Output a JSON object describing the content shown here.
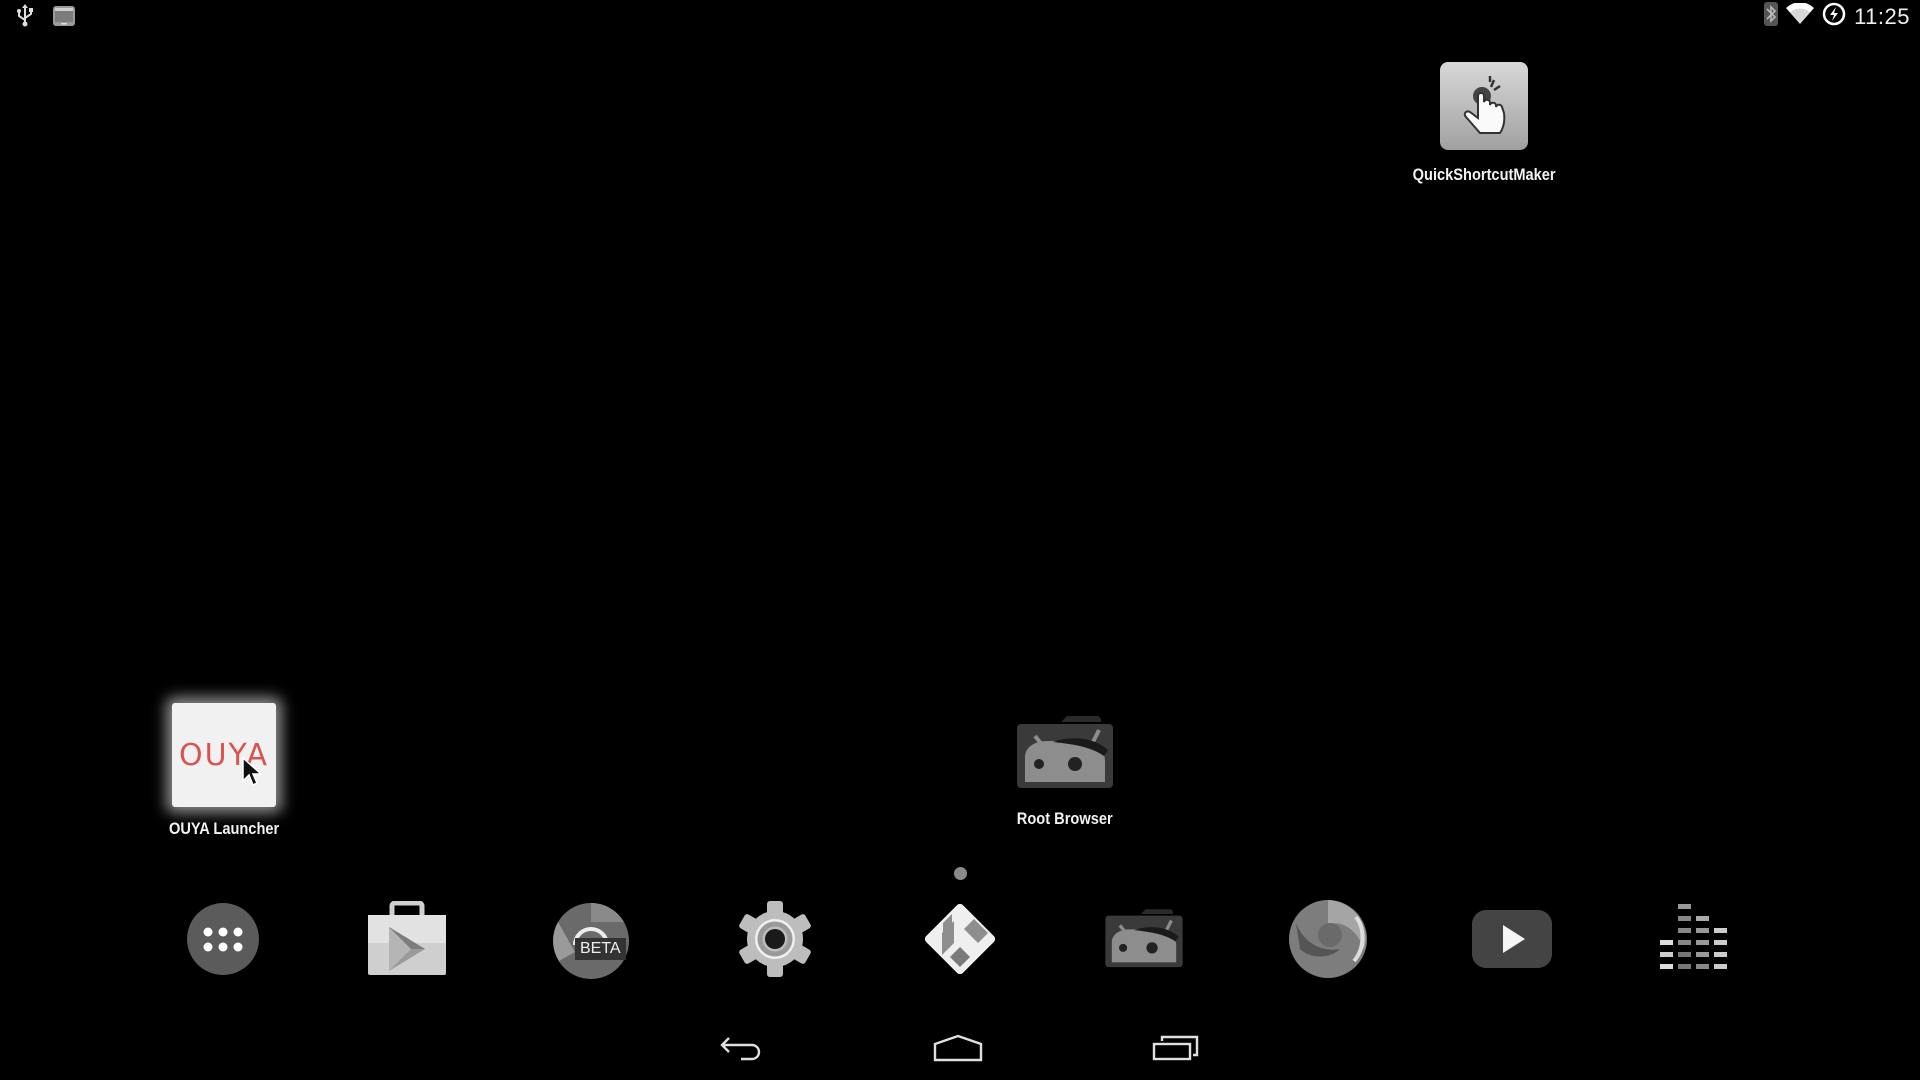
{
  "status_bar": {
    "left_icons": [
      "usb-icon",
      "screenshot-icon"
    ],
    "right_icons": [
      "bluetooth-icon",
      "wifi-icon",
      "data-saver-icon"
    ],
    "clock": "11:25"
  },
  "desktop": {
    "shortcuts": [
      {
        "label": "QuickShortcutMaker",
        "icon": "quickshortcutmaker-icon"
      },
      {
        "label": "OUYA Launcher",
        "icon": "ouya-launcher-icon",
        "tile_text": "OUYA"
      },
      {
        "label": "Root Browser",
        "icon": "root-browser-icon"
      }
    ],
    "page_indicator": {
      "pages": 1,
      "current": 1
    }
  },
  "dock": {
    "items": [
      {
        "name": "app-drawer",
        "icon": "all-apps-icon"
      },
      {
        "name": "play-store",
        "icon": "play-store-icon"
      },
      {
        "name": "chrome-beta",
        "icon": "chrome-beta-icon",
        "badge": "BETA"
      },
      {
        "name": "settings",
        "icon": "gear-icon"
      },
      {
        "name": "kodi",
        "icon": "kodi-icon"
      },
      {
        "name": "root-browser",
        "icon": "root-browser-icon"
      },
      {
        "name": "firefox",
        "icon": "firefox-icon"
      },
      {
        "name": "youtube",
        "icon": "youtube-icon"
      },
      {
        "name": "deezer",
        "icon": "equalizer-icon"
      }
    ]
  },
  "nav_bar": {
    "buttons": [
      "back",
      "home",
      "recents"
    ]
  },
  "cursor": {
    "over": "OUYA Launcher"
  }
}
